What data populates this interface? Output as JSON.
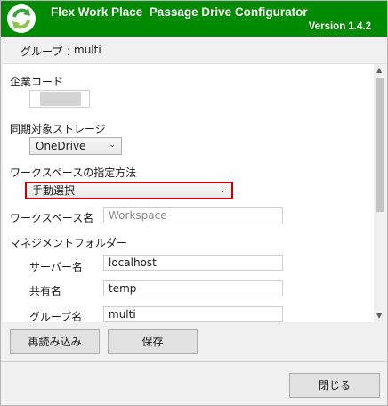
{
  "window": {
    "title": "Flex Work Place  Passage Drive Configurator",
    "version": "Version 1.4.2"
  },
  "group": {
    "label": "グループ ：",
    "value": "multi"
  },
  "form": {
    "company_code_label": "企業コード",
    "sync_storage_label": "同期対象ストレージ",
    "sync_storage_value": "OneDrive",
    "workspace_method_label": "ワークスペースの指定方法",
    "workspace_method_value": "手動選択",
    "workspace_name_label": "ワークスペース名",
    "workspace_name_placeholder": "Workspace",
    "management_folder_label": "マネジメントフォルダー",
    "server_name_label": "サーバー名",
    "server_name_value": "localhost",
    "share_name_label": "共有名",
    "share_name_value": "temp",
    "group_name_label": "グループ名",
    "group_name_value": "multi"
  },
  "buttons": {
    "reload": "再読み込み",
    "save": "保存",
    "close": "閉じる"
  },
  "colors": {
    "titlebar": "#008a00",
    "highlight_border": "#d40000"
  },
  "icons": {
    "logo": "sync-arrows-icon",
    "dropdown": "chevron-down-icon"
  }
}
